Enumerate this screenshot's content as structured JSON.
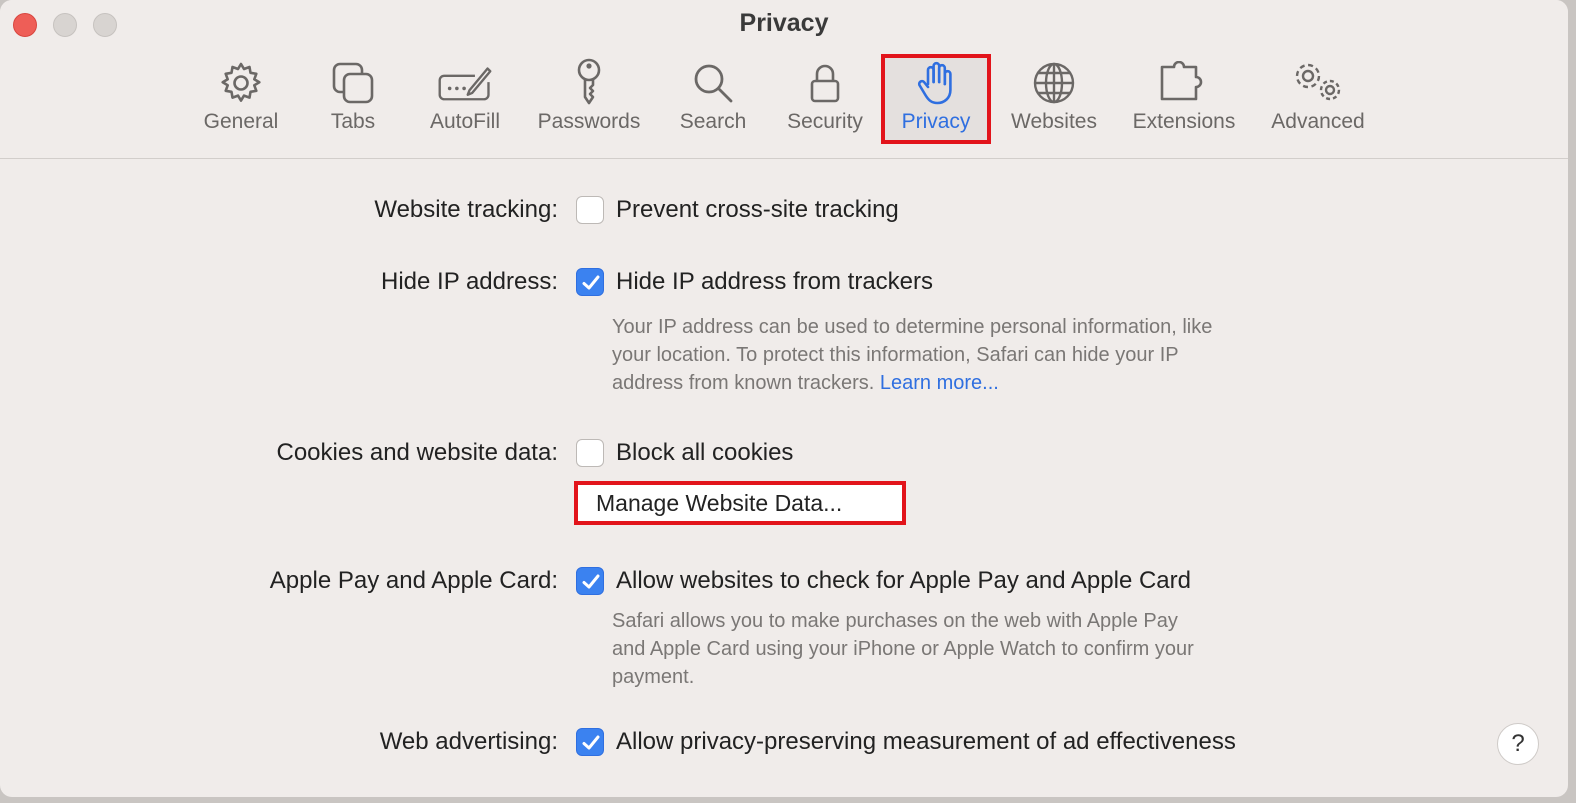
{
  "window": {
    "title": "Privacy"
  },
  "toolbar": {
    "items": [
      {
        "label": "General",
        "icon": "gear-icon"
      },
      {
        "label": "Tabs",
        "icon": "tabs-icon"
      },
      {
        "label": "AutoFill",
        "icon": "autofill-icon"
      },
      {
        "label": "Passwords",
        "icon": "key-icon"
      },
      {
        "label": "Search",
        "icon": "magnifier-icon"
      },
      {
        "label": "Security",
        "icon": "lock-icon"
      },
      {
        "label": "Privacy",
        "icon": "hand-icon",
        "selected": true
      },
      {
        "label": "Websites",
        "icon": "globe-icon"
      },
      {
        "label": "Extensions",
        "icon": "puzzle-icon"
      },
      {
        "label": "Advanced",
        "icon": "gears-icon"
      }
    ]
  },
  "settings": {
    "website_tracking": {
      "label": "Website tracking:",
      "option": "Prevent cross-site tracking",
      "checked": false
    },
    "hide_ip": {
      "label": "Hide IP address:",
      "option": "Hide IP address from trackers",
      "checked": true,
      "description_line1": "Your IP address can be used to determine personal information, like",
      "description_line2": "your location. To protect this information, Safari can hide your IP",
      "description_line3": "address from known trackers.",
      "learn_more": "Learn more..."
    },
    "cookies": {
      "label": "Cookies and website data:",
      "option": "Block all cookies",
      "checked": false,
      "button": "Manage Website Data..."
    },
    "apple_pay": {
      "label": "Apple Pay and Apple Card:",
      "option": "Allow websites to check for Apple Pay and Apple Card",
      "checked": true,
      "description_line1": "Safari allows you to make purchases on the web with Apple Pay",
      "description_line2": "and Apple Card using your iPhone or Apple Watch to confirm your",
      "description_line3": "payment."
    },
    "web_advertising": {
      "label": "Web advertising:",
      "option": "Allow privacy-preserving measurement of ad effectiveness",
      "checked": true
    }
  },
  "help": {
    "label": "?"
  },
  "colors": {
    "accent": "#3b82f0",
    "highlight": "#e2141b",
    "close": "#ee5e57"
  }
}
